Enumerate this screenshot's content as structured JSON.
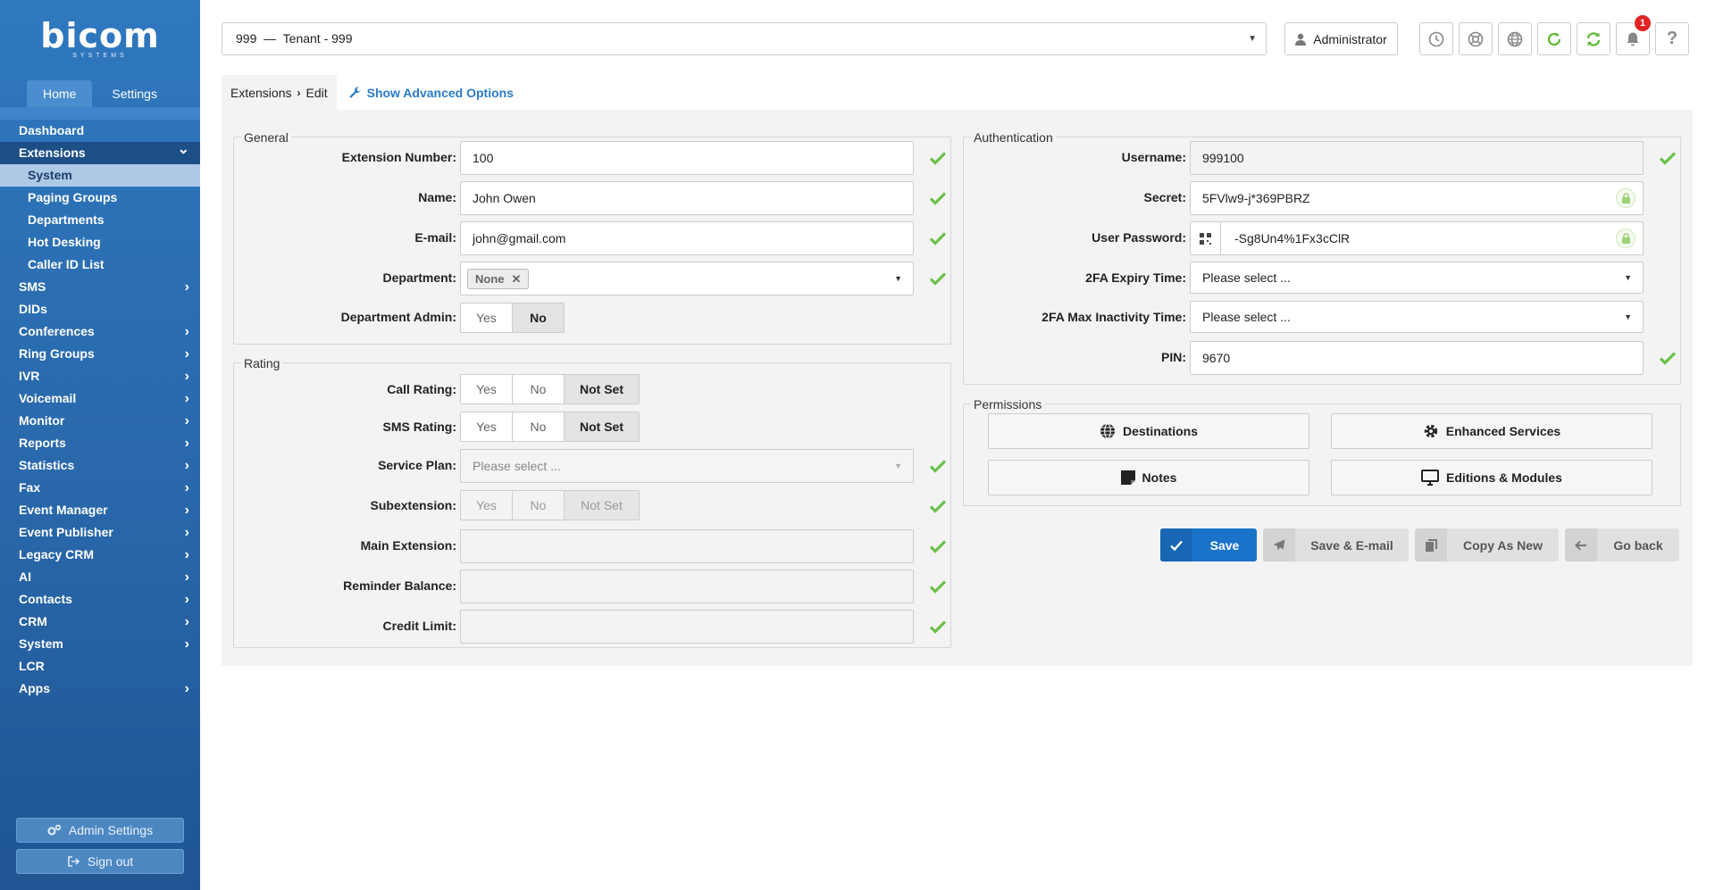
{
  "brand": {
    "logo": "bicom",
    "logo_sub": "SYSTEMS"
  },
  "sidebar": {
    "tabs": [
      "Home",
      "Settings"
    ],
    "items": [
      {
        "label": "Dashboard"
      },
      {
        "label": "Extensions",
        "open": true
      },
      {
        "label": "System",
        "sub": true,
        "active": true
      },
      {
        "label": "Paging Groups",
        "sub": true
      },
      {
        "label": "Departments",
        "sub": true
      },
      {
        "label": "Hot Desking",
        "sub": true
      },
      {
        "label": "Caller ID List",
        "sub": true
      },
      {
        "label": "SMS"
      },
      {
        "label": "DIDs"
      },
      {
        "label": "Conferences"
      },
      {
        "label": "Ring Groups"
      },
      {
        "label": "IVR"
      },
      {
        "label": "Voicemail"
      },
      {
        "label": "Monitor"
      },
      {
        "label": "Reports"
      },
      {
        "label": "Statistics"
      },
      {
        "label": "Fax"
      },
      {
        "label": "Event Manager"
      },
      {
        "label": "Event Publisher"
      },
      {
        "label": "Legacy CRM"
      },
      {
        "label": "AI"
      },
      {
        "label": "Contacts"
      },
      {
        "label": "CRM"
      },
      {
        "label": "System"
      },
      {
        "label": "LCR"
      },
      {
        "label": "Apps"
      }
    ],
    "admin_settings": "Admin Settings",
    "sign_out": "Sign out"
  },
  "topbar": {
    "tenant": "999  —  Tenant - 999",
    "user": "Administrator",
    "notifications_count": "1"
  },
  "breadcrumb": {
    "section": "Extensions",
    "page": "Edit",
    "advanced": "Show Advanced Options"
  },
  "general": {
    "legend": "General",
    "extension_number_label": "Extension Number:",
    "extension_number": "100",
    "name_label": "Name:",
    "name": "John Owen",
    "email_label": "E-mail:",
    "email": "john@gmail.com",
    "department_label": "Department:",
    "department": "None",
    "dept_admin_label": "Department Admin:",
    "yes": "Yes",
    "no": "No"
  },
  "rating": {
    "legend": "Rating",
    "call_rating_label": "Call Rating:",
    "sms_rating_label": "SMS Rating:",
    "service_plan_label": "Service Plan:",
    "service_plan_placeholder": "Please select ...",
    "subextension_label": "Subextension:",
    "main_extension_label": "Main Extension:",
    "reminder_balance_label": "Reminder Balance:",
    "credit_limit_label": "Credit Limit:",
    "yes": "Yes",
    "no": "No",
    "not_set": "Not Set"
  },
  "auth": {
    "legend": "Authentication",
    "username_label": "Username:",
    "username": "999100",
    "secret_label": "Secret:",
    "secret": "5FVlw9-j*369PBRZ",
    "user_password_label": "User Password:",
    "user_password": "-Sg8Un4%1Fx3cClR",
    "fa_expiry_label": "2FA Expiry Time:",
    "fa_expiry": "Please select ...",
    "fa_inactivity_label": "2FA Max Inactivity Time:",
    "fa_inactivity": "Please select ...",
    "pin_label": "PIN:",
    "pin": "9670"
  },
  "permissions": {
    "legend": "Permissions",
    "destinations": "Destinations",
    "enhanced_services": "Enhanced Services",
    "notes": "Notes",
    "editions_modules": "Editions & Modules"
  },
  "actions": {
    "save": "Save",
    "save_email": "Save & E-mail",
    "copy_as_new": "Copy As New",
    "go_back": "Go back"
  },
  "colors": {
    "sidebar": "#2866a8",
    "primary": "#1a73c9",
    "check": "#6cc04a",
    "badge": "#e02424"
  }
}
